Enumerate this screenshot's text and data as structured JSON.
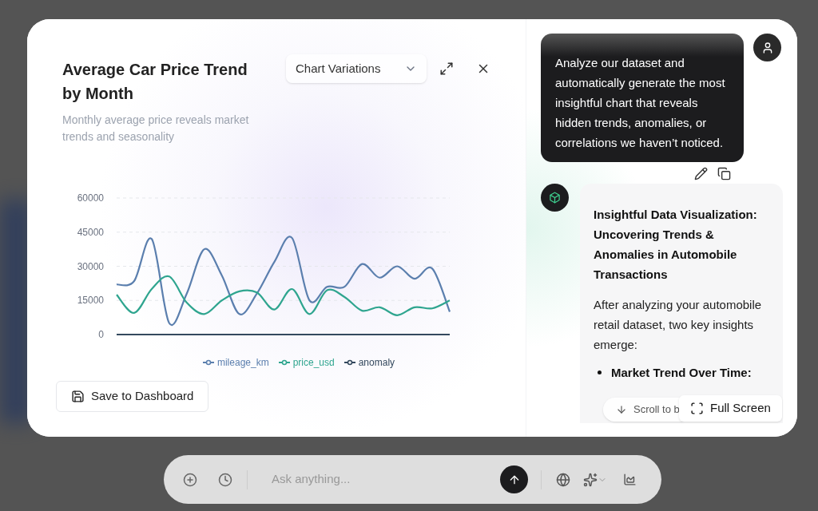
{
  "chart_panel": {
    "title": "Average Car Price Trend by Month",
    "subtitle": "Monthly average price reveals market trends and seasonality",
    "variations_dropdown": {
      "label": "Chart Variations"
    },
    "chart_data": {
      "type": "line",
      "grid": true,
      "legend": "bottom",
      "ylim": [
        0,
        60000
      ],
      "yticks": [
        0,
        15000,
        30000,
        45000,
        60000
      ],
      "series": [
        {
          "name": "mileage_km",
          "color": "#5b7fae",
          "values": [
            22000,
            23500,
            42000,
            5000,
            18000,
            37500,
            26000,
            9000,
            18000,
            32000,
            42500,
            15000,
            21000,
            21000,
            31000,
            25000,
            30000,
            24500,
            29000,
            10000
          ]
        },
        {
          "name": "price_usd",
          "color": "#2fa58f",
          "values": [
            17500,
            9500,
            20000,
            25500,
            14000,
            9000,
            15000,
            19000,
            18500,
            11000,
            20000,
            9000,
            19500,
            16500,
            10500,
            12000,
            8500,
            12000,
            11500,
            15000
          ]
        },
        {
          "name": "anomaly",
          "color": "#34495e",
          "values": [
            0,
            0,
            0,
            0,
            0,
            0,
            0,
            0,
            0,
            0,
            0,
            0,
            0,
            0,
            0,
            0,
            0,
            0,
            0,
            0
          ]
        }
      ]
    },
    "save_button": "Save to Dashboard"
  },
  "chat": {
    "user_message": "Analyze our dataset and automatically generate the most insightful chart that reveals hidden trends, anomalies, or correlations we haven’t noticed.",
    "answer": {
      "heading": "Insightful Data Visualization: Uncovering Trends & Anomalies in Automobile Transactions",
      "intro": "After analyzing your automobile retail dataset, two key insights emerge:",
      "bullets": [
        {
          "title": "Market Trend Over Time:"
        }
      ]
    },
    "scroll_button": "Scroll to b",
    "full_screen_button": "Full Screen"
  },
  "composer": {
    "placeholder": "Ask anything..."
  }
}
